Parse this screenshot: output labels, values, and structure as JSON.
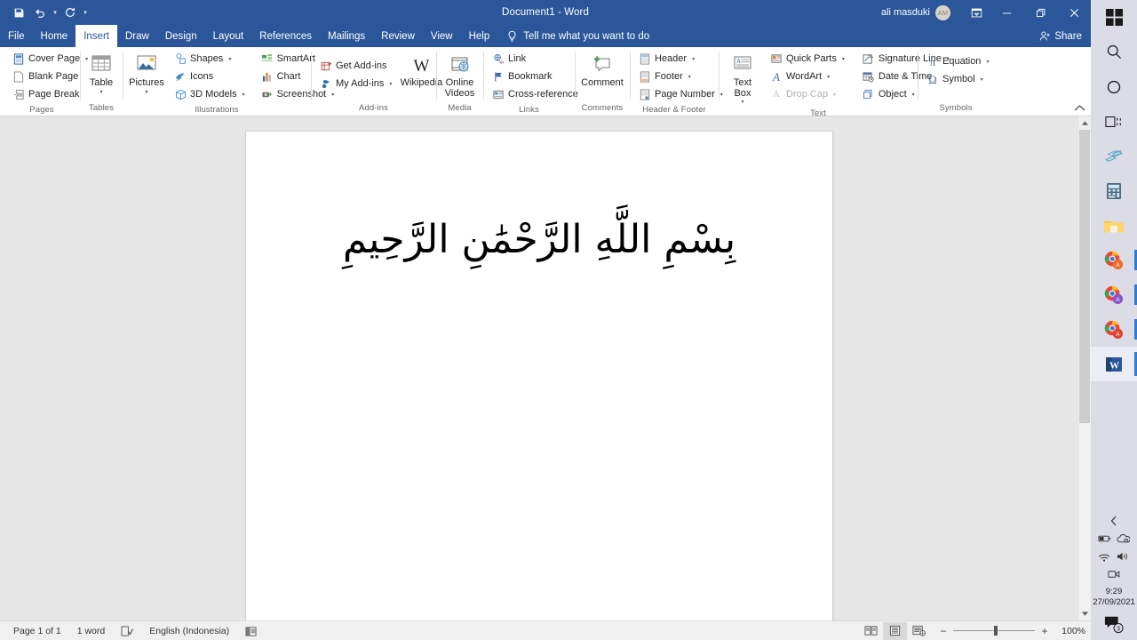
{
  "titlebar": {
    "document_title": "Document1  -  Word",
    "user_name": "ali masduki",
    "avatar_initials": "AM",
    "save_icon": "save-icon",
    "undo_icon": "undo-icon",
    "redo_icon": "redo-icon",
    "customize_qat_icon": "customize-quick-access-toolbar-icon",
    "ribbon_display_icon": "ribbon-display-options-icon",
    "minimize_icon": "minimize-icon",
    "restore_icon": "restore-down-icon",
    "close_icon": "close-icon"
  },
  "tabs": [
    {
      "label": "File",
      "active": false
    },
    {
      "label": "Home",
      "active": false
    },
    {
      "label": "Insert",
      "active": true
    },
    {
      "label": "Draw",
      "active": false
    },
    {
      "label": "Design",
      "active": false
    },
    {
      "label": "Layout",
      "active": false
    },
    {
      "label": "References",
      "active": false
    },
    {
      "label": "Mailings",
      "active": false
    },
    {
      "label": "Review",
      "active": false
    },
    {
      "label": "View",
      "active": false
    },
    {
      "label": "Help",
      "active": false
    }
  ],
  "tellme": {
    "label": "Tell me what you want to do",
    "icon": "lightbulb-icon"
  },
  "share": {
    "label": "Share",
    "icon": "share-person-icon"
  },
  "ribbon": {
    "collapse_icon": "collapse-ribbon-chevron-icon",
    "groups": [
      {
        "name": "Pages",
        "label": "Pages",
        "items": [
          {
            "label": "Cover Page",
            "icon": "cover-page-icon",
            "caret": true
          },
          {
            "label": "Blank Page",
            "icon": "blank-page-icon",
            "caret": false
          },
          {
            "label": "Page Break",
            "icon": "page-break-icon",
            "caret": false
          }
        ]
      },
      {
        "name": "Tables",
        "label": "Tables",
        "big": [
          {
            "label": "Table",
            "icon": "table-icon",
            "caret": true
          }
        ]
      },
      {
        "name": "Illustrations",
        "label": "Illustrations",
        "big": [
          {
            "label": "Pictures",
            "icon": "pictures-icon",
            "caret": true
          }
        ],
        "items": [
          {
            "label": "Shapes",
            "icon": "shapes-icon",
            "caret": true
          },
          {
            "label": "Icons",
            "icon": "icons-icon",
            "caret": false
          },
          {
            "label": "3D Models",
            "icon": "3d-models-icon",
            "caret": true
          }
        ],
        "items2": [
          {
            "label": "SmartArt",
            "icon": "smartart-icon",
            "caret": false
          },
          {
            "label": "Chart",
            "icon": "chart-icon",
            "caret": false
          },
          {
            "label": "Screenshot",
            "icon": "screenshot-icon",
            "caret": true
          }
        ]
      },
      {
        "name": "Add-ins",
        "label": "Add-ins",
        "items": [
          {
            "label": "Get Add-ins",
            "icon": "get-add-ins-icon",
            "caret": false
          },
          {
            "label": "My Add-ins",
            "icon": "my-add-ins-icon",
            "caret": true
          }
        ],
        "big": [
          {
            "label": "Wikipedia",
            "icon": "wikipedia-icon",
            "caret": false
          }
        ]
      },
      {
        "name": "Media",
        "label": "Media",
        "big": [
          {
            "label": "Online Videos",
            "icon": "online-videos-icon",
            "caret": false
          }
        ]
      },
      {
        "name": "Links",
        "label": "Links",
        "items": [
          {
            "label": "Link",
            "icon": "link-icon",
            "caret": false
          },
          {
            "label": "Bookmark",
            "icon": "bookmark-flag-icon",
            "caret": false
          },
          {
            "label": "Cross-reference",
            "icon": "cross-reference-icon",
            "caret": false
          }
        ]
      },
      {
        "name": "Comments",
        "label": "Comments",
        "big": [
          {
            "label": "Comment",
            "icon": "new-comment-icon",
            "caret": false
          }
        ]
      },
      {
        "name": "Header & Footer",
        "label": "Header & Footer",
        "items": [
          {
            "label": "Header",
            "icon": "header-icon",
            "caret": true
          },
          {
            "label": "Footer",
            "icon": "footer-icon",
            "caret": true
          },
          {
            "label": "Page Number",
            "icon": "page-number-icon",
            "caret": true
          }
        ]
      },
      {
        "name": "Text",
        "label": "Text",
        "big": [
          {
            "label": "Text Box",
            "icon": "text-box-icon",
            "caret": true
          }
        ],
        "items": [
          {
            "label": "Quick Parts",
            "icon": "quick-parts-icon",
            "caret": true
          },
          {
            "label": "WordArt",
            "icon": "wordart-icon",
            "caret": true
          },
          {
            "label": "Drop Cap",
            "icon": "drop-cap-icon",
            "caret": true,
            "disabled": true
          }
        ],
        "items2": [
          {
            "label": "Signature Line",
            "icon": "signature-line-icon",
            "caret": true
          },
          {
            "label": "Date & Time",
            "icon": "date-and-time-icon",
            "caret": false
          },
          {
            "label": "Object",
            "icon": "object-icon",
            "caret": true
          }
        ]
      },
      {
        "name": "Symbols",
        "label": "Symbols",
        "items": [
          {
            "label": "Equation",
            "icon": "equation-pi-icon",
            "caret": true
          },
          {
            "label": "Symbol",
            "icon": "symbol-omega-icon",
            "caret": true
          }
        ]
      }
    ]
  },
  "document": {
    "body_text": "بِسْمِ اللَّهِ الرَّحْمَٰنِ الرَّحِيمِ"
  },
  "scrollbar": {
    "up_arrow_icon": "scroll-up-arrow-icon",
    "down_arrow_icon": "scroll-down-arrow-icon",
    "split_handle_icon": "split-window-handle-icon"
  },
  "statusbar": {
    "page": "Page 1 of 1",
    "words": "1 word",
    "proofing_icon": "proofing-errors-icon",
    "language": "English (Indonesia)",
    "accessibility_icon": "accessibility-checker-icon",
    "views": [
      {
        "name": "read-mode",
        "icon": "read-mode-icon",
        "active": false
      },
      {
        "name": "print-layout",
        "icon": "print-layout-icon",
        "active": true
      },
      {
        "name": "web-layout",
        "icon": "web-layout-icon",
        "active": false
      }
    ],
    "zoom_out": "−",
    "zoom_in": "+",
    "zoom_value": "100%"
  },
  "taskbar": {
    "items": [
      {
        "name": "start-button",
        "icon": "windows-logo-icon",
        "state": "none"
      },
      {
        "name": "search-button",
        "icon": "search-icon",
        "state": "none"
      },
      {
        "name": "cortana-button",
        "icon": "cortana-circle-icon",
        "state": "none"
      },
      {
        "name": "task-view-button",
        "icon": "task-view-icon",
        "state": "none"
      },
      {
        "name": "file-explorer-legacy",
        "icon": "books-icon",
        "state": "none"
      },
      {
        "name": "calculator",
        "icon": "calculator-icon",
        "state": "none"
      },
      {
        "name": "file-explorer",
        "icon": "folder-icon",
        "state": "none"
      },
      {
        "name": "chrome-window-1",
        "icon": "chrome-icon",
        "state": "running"
      },
      {
        "name": "chrome-window-2",
        "icon": "chrome-icon",
        "state": "running"
      },
      {
        "name": "chrome-window-3",
        "icon": "chrome-icon",
        "state": "running"
      },
      {
        "name": "word-window",
        "icon": "word-icon",
        "state": "active"
      }
    ],
    "tray": {
      "expand_icon": "show-hidden-icons-chevron",
      "battery_icon": "battery-icon",
      "onedrive_icon": "onedrive-icon",
      "wifi_icon": "wifi-icon",
      "volume_icon": "volume-icon",
      "meet_now_icon": "meet-now-icon",
      "time": "9:29",
      "date": "27/09/2021",
      "notification_icon": "action-center-icon",
      "notification_count": "3"
    }
  },
  "colors": {
    "word_blue": "#2b579a",
    "ribbon_bg": "#ffffff",
    "doc_bg": "#e6e6e6",
    "taskbar_bg": "#dcdce6",
    "accent_blue": "#2b7cd3"
  }
}
